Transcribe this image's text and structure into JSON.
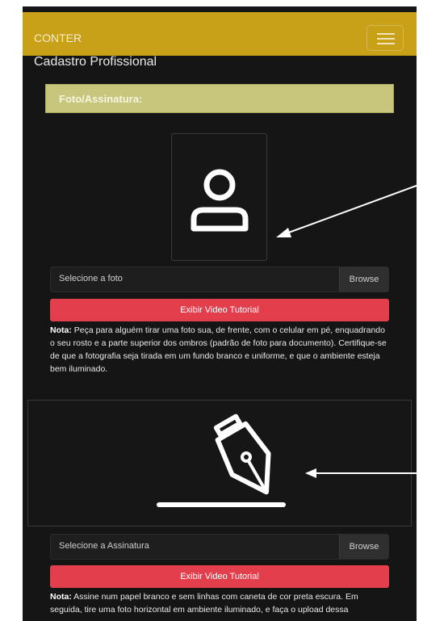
{
  "app": {
    "brand": "CONTER",
    "page_title": "Cadastro Profissional"
  },
  "section": {
    "title": "Foto/Assinatura:"
  },
  "photo": {
    "input_label": "Selecione a foto",
    "browse_label": "Browse",
    "tutorial_button": "Exibir Video Tutorial",
    "note_prefix": "Nota:",
    "note_text": " Peça para alguém tirar uma foto sua, de frente, com o celular em pé, enquadrando o seu rosto e a parte superior dos ombros (padrão de foto para documento). Certifique-se de que a fotografia seja tirada em um fundo branco e uniforme, e que o ambiente esteja bem iluminado."
  },
  "signature": {
    "input_label": "Selecione a Assinatura",
    "browse_label": "Browse",
    "tutorial_button": "Exibir Video Tutorial",
    "note_prefix": "Nota:",
    "note_text": " Assine num papel branco e sem linhas com caneta de cor preta escura. Em seguida, tire uma foto horizontal em ambiente iluminado, e faça o upload dessa"
  },
  "icons": {
    "menu": "hamburger-menu-icon",
    "photo": "user-icon",
    "signature": "pen-nib-icon"
  },
  "colors": {
    "navbar": "#c8a119",
    "section_bar": "#c7c67c",
    "tutorial_button": "#e23e4c",
    "background": "#151515"
  }
}
